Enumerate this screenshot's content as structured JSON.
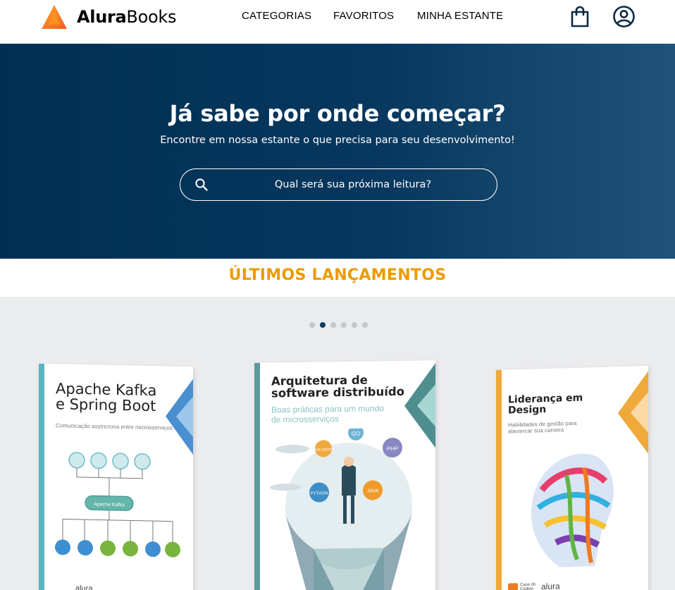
{
  "header": {
    "brand_bold": "Alura",
    "brand_light": "Books",
    "nav": [
      "CATEGORIAS",
      "FAVORITOS",
      "MINHA ESTANTE"
    ],
    "icons": [
      "bag-icon",
      "user-icon"
    ]
  },
  "hero": {
    "title": "Já sabe por onde começar?",
    "subtitle": "Encontre em nossa estante o que precisa para seu desenvolvimento!",
    "search_placeholder": "Qual será sua próxima leitura?"
  },
  "releases": {
    "title": "ÚLTIMOS LANÇAMENTOS",
    "dots": 6,
    "active_dot": 1,
    "books": [
      {
        "title": "Apache Kafka e Spring Boot",
        "subtitle": "Comunicação assíncrona entre microsserviços",
        "center_label": "Apache Kafka",
        "accent": "#5ab4c4",
        "corner": "#4a8fd0",
        "publisher": "alura"
      },
      {
        "title": "Arquitetura de software distribuído",
        "subtitle": "Boas práticas para um mundo de microsserviços",
        "badges": [
          "GO",
          "JAVA SCRIPT",
          "PHP",
          "PYTHON",
          "JAVA"
        ],
        "accent": "#5a9c9c",
        "corner": "#4f8e8e"
      },
      {
        "title": "Liderança em Design",
        "subtitle": "Habilidades de gestão para alavancar sua carreira",
        "accent": "#f0a93b",
        "corner": "#f0a93b",
        "publisher_a": "Casa do Código",
        "publisher": "alura"
      }
    ]
  },
  "colors": {
    "hero_dark": "#002f52",
    "accent_orange": "#eb9b00",
    "carousel_bg": "#ebecee"
  }
}
